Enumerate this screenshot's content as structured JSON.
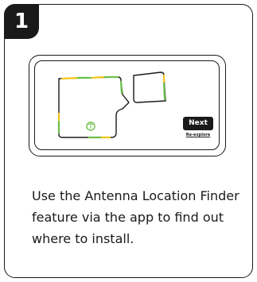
{
  "step": {
    "number": "1"
  },
  "device": {
    "next_label": "Next",
    "reexplore_label": "Re-explore",
    "antenna_icon": "antenna-icon",
    "accent_colors": {
      "green": "#6cc04a",
      "yellow": "#f5c518",
      "outline": "#1a1a1a"
    }
  },
  "instruction": {
    "text": "Use the Antenna Location Finder feature via the app to find out where to install."
  }
}
